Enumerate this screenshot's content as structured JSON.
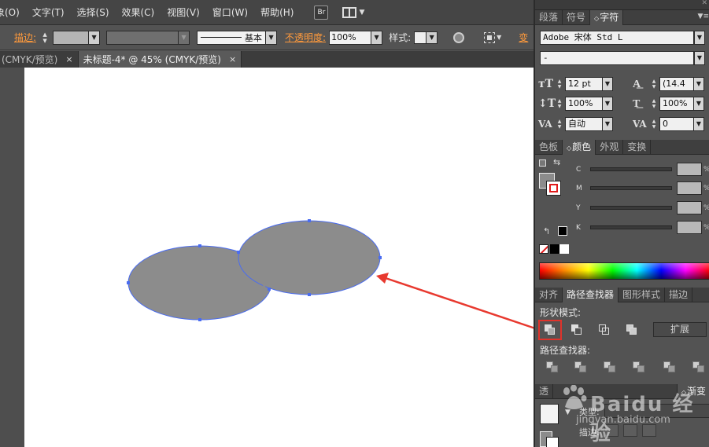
{
  "menubar": {
    "items": [
      "象(O)",
      "文字(T)",
      "选择(S)",
      "效果(C)",
      "视图(V)",
      "窗口(W)",
      "帮助(H)"
    ],
    "bridge_badge": "Br"
  },
  "control_bar": {
    "stroke_label": "描边:",
    "stroke_style": "基本",
    "opacity_label": "不透明度:",
    "opacity_value": "100%",
    "style_label": "样式:",
    "transform_label": "变"
  },
  "tabs": [
    {
      "label": "(CMYK/预览)",
      "close": "×"
    },
    {
      "label": "未标题-4* @ 45% (CMYK/预览)",
      "close": "×"
    }
  ],
  "character_panel": {
    "tabs": [
      "段落",
      "符号",
      "字符"
    ],
    "font_family": "Adobe 宋体 Std L",
    "font_style": "-",
    "size": "12 pt",
    "leading": "(14.4",
    "vertical_scale": "100%",
    "horizontal_scale": "100%",
    "kerning": "自动",
    "tracking": "0"
  },
  "color_panel": {
    "tabs": [
      "色板",
      "颜色",
      "外观",
      "变换"
    ],
    "channels": [
      "C",
      "M",
      "Y",
      "K"
    ],
    "percent": "%"
  },
  "pathfinder_panel": {
    "tabs": [
      "对齐",
      "路径查找器",
      "图形样式",
      "描边"
    ],
    "shape_modes_label": "形状模式:",
    "expand_label": "扩展",
    "pathfinders_label": "路径查找器:"
  },
  "gradient_panel": {
    "tabs": [
      "透",
      "渐变"
    ],
    "type_label": "类型:",
    "stroke_label": "描边:"
  },
  "watermark": {
    "brand": "Baidu 经验",
    "url": "jingyan.baidu.com"
  },
  "colors": {
    "shape_fill": "#8c8c8c",
    "shape_stroke": "#4a6cf0",
    "arrow": "#e8392f",
    "accent_label": "#ff9a3c"
  }
}
